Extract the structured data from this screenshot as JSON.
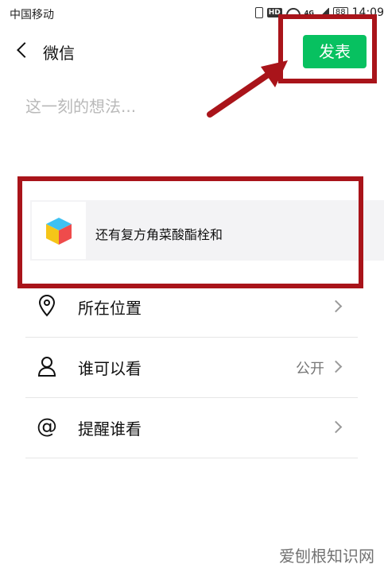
{
  "status_bar": {
    "carrier": "中国移动",
    "network": "4G",
    "battery": "88",
    "time": "14:09",
    "icons": [
      "vibrate-icon",
      "hd-icon",
      "wifi-icon",
      "signal-icon",
      "battery-icon"
    ]
  },
  "header": {
    "title": "微信",
    "post_label": "发表"
  },
  "compose": {
    "placeholder": "这一刻的想法..."
  },
  "link_card": {
    "title": "还有复方角菜酸酯栓和",
    "thumb_icon": "cube-app-icon"
  },
  "options": [
    {
      "label": "所在位置",
      "value": "",
      "icon": "location-pin-icon"
    },
    {
      "label": "谁可以看",
      "value": "公开",
      "icon": "person-icon"
    },
    {
      "label": "提醒谁看",
      "value": "",
      "icon": "at-icon"
    }
  ],
  "watermark": "爱刨根知识网",
  "colors": {
    "accent_green": "#07c160",
    "annotation_red": "#a9141a"
  }
}
